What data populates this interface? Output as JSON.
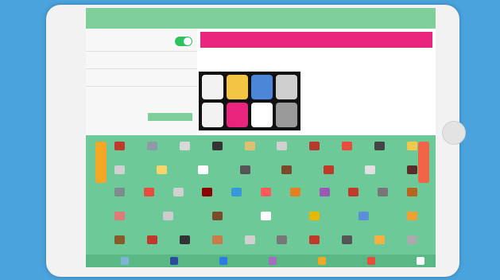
{
  "settings": {
    "rows": [
      {
        "label": "",
        "toggle": true
      },
      {
        "label": ""
      },
      {
        "label": ""
      },
      {
        "label": ""
      },
      {
        "label": ""
      }
    ],
    "button_label": ""
  },
  "panel": {
    "header": "",
    "description": ""
  },
  "apps": [
    {
      "name": "",
      "color": "#f2f2f2"
    },
    {
      "name": "",
      "color": "#f4c542"
    },
    {
      "name": "",
      "color": "#4b86d9"
    },
    {
      "name": "",
      "color": "#cfcfcf"
    },
    {
      "name": "",
      "color": "#f2f2f2"
    },
    {
      "name": "",
      "color": "#e8247c"
    },
    {
      "name": "",
      "color": "#ffffff"
    },
    {
      "name": "",
      "color": "#9a9a9a"
    }
  ],
  "board": {
    "left_tab": "",
    "right_tab": "",
    "symbols": [
      "#c0392b",
      "#8e9aa8",
      "#d8d8d8",
      "#333333",
      "#e0c070",
      "#d0d0d0",
      "#b33a2c",
      "#e74c3c",
      "#444444",
      "#f2c94c",
      "#d0d0d0",
      "#f6d36b",
      "#ffffff",
      "#555555",
      "#7a4a2a",
      "#c0392b",
      "#e0e0e0",
      "#5a2c2c",
      "#7f8c8d",
      "#e74c3c",
      "#d0d0d0",
      "#8b0000",
      "#3498db",
      "#ff5a5a",
      "#e67e22",
      "#9b59b6",
      "#c0392b",
      "#777777",
      "#b5651d",
      "#e07a7a",
      "#cccccc",
      "#7a4a2a",
      "#ffffff",
      "#e6b800",
      "#5b8fd9",
      "#f0a030",
      "#8b5a2b",
      "#c0392b",
      "#333333",
      "#c97b4a",
      "#d0d0d0",
      "#777777",
      "#c0392b",
      "#555555",
      "#f5b041",
      "#aaaaaa"
    ]
  },
  "bottom_bar": {
    "icons": [
      "#7fb3d5",
      "#2e4a9e",
      "#2c7be5",
      "#a56cc1",
      "#f5a623",
      "#e74c3c",
      "#ffffff"
    ]
  }
}
